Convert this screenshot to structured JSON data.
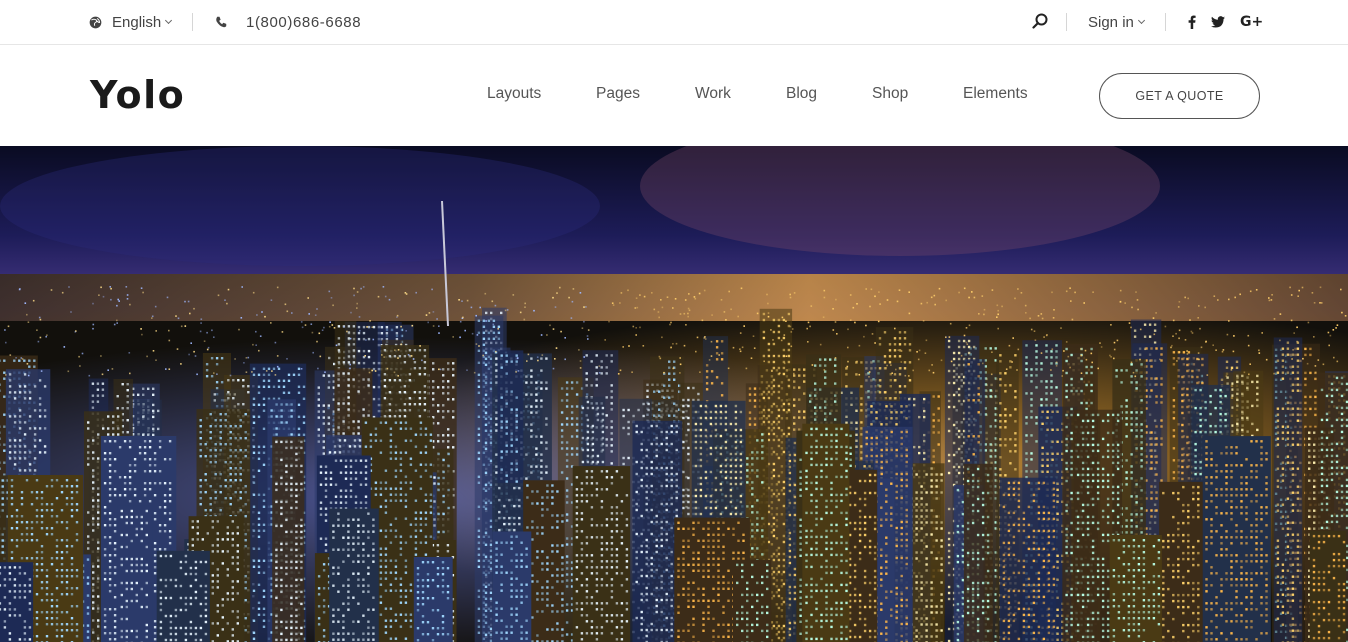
{
  "topbar": {
    "language": "English",
    "phone": "1(800)686-6688",
    "sign_in": "Sign in",
    "social": [
      "f",
      "twitter",
      "G+"
    ]
  },
  "header": {
    "logo": "Yolo",
    "nav": [
      "Layouts",
      "Pages",
      "Work",
      "Blog",
      "Shop",
      "Elements"
    ],
    "cta": "GET A QUOTE"
  },
  "hero": {
    "image": "night-city-skyline",
    "colors": {
      "sky_top": "#0d0f33",
      "sky_mid": "#3a2a7a",
      "horizon": "#c28a2a",
      "lights": "#ffc24a"
    }
  },
  "icons": [
    "globe-icon",
    "phone-icon",
    "search-icon",
    "facebook-icon",
    "twitter-icon",
    "google-plus-icon"
  ]
}
